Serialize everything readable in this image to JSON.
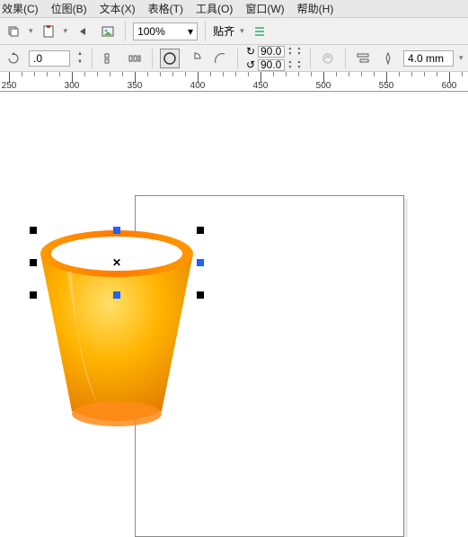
{
  "menu": {
    "effects": "效果(C)",
    "bitmap": "位图(B)",
    "text": "文本(X)",
    "table": "表格(T)",
    "tools": "工具(O)",
    "window": "窗口(W)",
    "help": "帮助(H)"
  },
  "toolbar1": {
    "zoom": "100%",
    "align_label": "贴齐"
  },
  "toolbar2": {
    "num": ".0",
    "rot1": "90.0",
    "rot2": "90.0",
    "outline_val": "4.0 mm"
  },
  "ruler": {
    "labels": [
      "250",
      "300",
      "350",
      "400",
      "450",
      "500",
      "550",
      "600"
    ]
  }
}
